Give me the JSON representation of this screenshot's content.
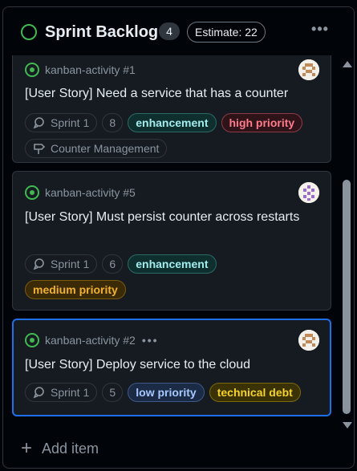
{
  "column": {
    "title": "Sprint Backlog",
    "count": "4",
    "estimate": "Estimate: 22",
    "more_icon": "kebab-horizontal-icon",
    "add_item_label": "Add item"
  },
  "cards": [
    {
      "ref": "kanban-activity #1",
      "title": "[User Story] Need a service that has a counter",
      "sprint": "Sprint 1",
      "points": "8",
      "labels": [
        "enhancement",
        "high priority"
      ],
      "milestone": "Counter Management",
      "avatar_color": "#c08a5a"
    },
    {
      "ref": "kanban-activity #5",
      "title": "[User Story] Must persist counter across restarts",
      "sprint": "Sprint 1",
      "points": "6",
      "labels": [
        "enhancement",
        "medium priority"
      ],
      "avatar_color": "#9a6bc7"
    },
    {
      "ref": "kanban-activity #2",
      "more": "•••",
      "title": "[User Story] Deploy service to the cloud",
      "sprint": "Sprint 1",
      "points": "5",
      "labels": [
        "low priority",
        "technical debt"
      ],
      "avatar_color": "#c08a5a"
    }
  ],
  "colors": {
    "accent": "#1f6feb",
    "status_open": "#3fb950",
    "background": "#010409",
    "card": "#161b22"
  }
}
